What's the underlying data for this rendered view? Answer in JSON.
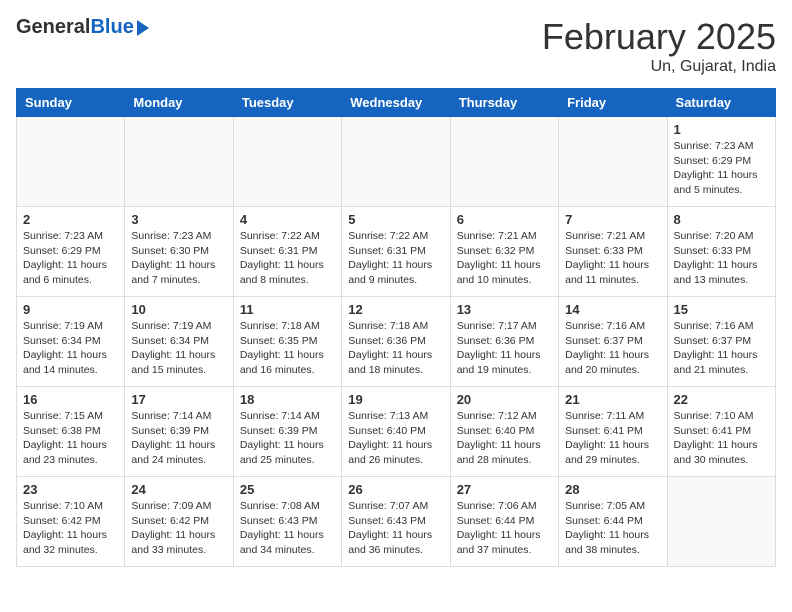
{
  "header": {
    "logo_general": "General",
    "logo_blue": "Blue",
    "title": "February 2025",
    "subtitle": "Un, Gujarat, India"
  },
  "weekdays": [
    "Sunday",
    "Monday",
    "Tuesday",
    "Wednesday",
    "Thursday",
    "Friday",
    "Saturday"
  ],
  "weeks": [
    [
      {
        "day": "",
        "info": ""
      },
      {
        "day": "",
        "info": ""
      },
      {
        "day": "",
        "info": ""
      },
      {
        "day": "",
        "info": ""
      },
      {
        "day": "",
        "info": ""
      },
      {
        "day": "",
        "info": ""
      },
      {
        "day": "1",
        "info": "Sunrise: 7:23 AM\nSunset: 6:29 PM\nDaylight: 11 hours\nand 5 minutes."
      }
    ],
    [
      {
        "day": "2",
        "info": "Sunrise: 7:23 AM\nSunset: 6:29 PM\nDaylight: 11 hours\nand 6 minutes."
      },
      {
        "day": "3",
        "info": "Sunrise: 7:23 AM\nSunset: 6:30 PM\nDaylight: 11 hours\nand 7 minutes."
      },
      {
        "day": "4",
        "info": "Sunrise: 7:22 AM\nSunset: 6:31 PM\nDaylight: 11 hours\nand 8 minutes."
      },
      {
        "day": "5",
        "info": "Sunrise: 7:22 AM\nSunset: 6:31 PM\nDaylight: 11 hours\nand 9 minutes."
      },
      {
        "day": "6",
        "info": "Sunrise: 7:21 AM\nSunset: 6:32 PM\nDaylight: 11 hours\nand 10 minutes."
      },
      {
        "day": "7",
        "info": "Sunrise: 7:21 AM\nSunset: 6:33 PM\nDaylight: 11 hours\nand 11 minutes."
      },
      {
        "day": "8",
        "info": "Sunrise: 7:20 AM\nSunset: 6:33 PM\nDaylight: 11 hours\nand 13 minutes."
      }
    ],
    [
      {
        "day": "9",
        "info": "Sunrise: 7:19 AM\nSunset: 6:34 PM\nDaylight: 11 hours\nand 14 minutes."
      },
      {
        "day": "10",
        "info": "Sunrise: 7:19 AM\nSunset: 6:34 PM\nDaylight: 11 hours\nand 15 minutes."
      },
      {
        "day": "11",
        "info": "Sunrise: 7:18 AM\nSunset: 6:35 PM\nDaylight: 11 hours\nand 16 minutes."
      },
      {
        "day": "12",
        "info": "Sunrise: 7:18 AM\nSunset: 6:36 PM\nDaylight: 11 hours\nand 18 minutes."
      },
      {
        "day": "13",
        "info": "Sunrise: 7:17 AM\nSunset: 6:36 PM\nDaylight: 11 hours\nand 19 minutes."
      },
      {
        "day": "14",
        "info": "Sunrise: 7:16 AM\nSunset: 6:37 PM\nDaylight: 11 hours\nand 20 minutes."
      },
      {
        "day": "15",
        "info": "Sunrise: 7:16 AM\nSunset: 6:37 PM\nDaylight: 11 hours\nand 21 minutes."
      }
    ],
    [
      {
        "day": "16",
        "info": "Sunrise: 7:15 AM\nSunset: 6:38 PM\nDaylight: 11 hours\nand 23 minutes."
      },
      {
        "day": "17",
        "info": "Sunrise: 7:14 AM\nSunset: 6:39 PM\nDaylight: 11 hours\nand 24 minutes."
      },
      {
        "day": "18",
        "info": "Sunrise: 7:14 AM\nSunset: 6:39 PM\nDaylight: 11 hours\nand 25 minutes."
      },
      {
        "day": "19",
        "info": "Sunrise: 7:13 AM\nSunset: 6:40 PM\nDaylight: 11 hours\nand 26 minutes."
      },
      {
        "day": "20",
        "info": "Sunrise: 7:12 AM\nSunset: 6:40 PM\nDaylight: 11 hours\nand 28 minutes."
      },
      {
        "day": "21",
        "info": "Sunrise: 7:11 AM\nSunset: 6:41 PM\nDaylight: 11 hours\nand 29 minutes."
      },
      {
        "day": "22",
        "info": "Sunrise: 7:10 AM\nSunset: 6:41 PM\nDaylight: 11 hours\nand 30 minutes."
      }
    ],
    [
      {
        "day": "23",
        "info": "Sunrise: 7:10 AM\nSunset: 6:42 PM\nDaylight: 11 hours\nand 32 minutes."
      },
      {
        "day": "24",
        "info": "Sunrise: 7:09 AM\nSunset: 6:42 PM\nDaylight: 11 hours\nand 33 minutes."
      },
      {
        "day": "25",
        "info": "Sunrise: 7:08 AM\nSunset: 6:43 PM\nDaylight: 11 hours\nand 34 minutes."
      },
      {
        "day": "26",
        "info": "Sunrise: 7:07 AM\nSunset: 6:43 PM\nDaylight: 11 hours\nand 36 minutes."
      },
      {
        "day": "27",
        "info": "Sunrise: 7:06 AM\nSunset: 6:44 PM\nDaylight: 11 hours\nand 37 minutes."
      },
      {
        "day": "28",
        "info": "Sunrise: 7:05 AM\nSunset: 6:44 PM\nDaylight: 11 hours\nand 38 minutes."
      },
      {
        "day": "",
        "info": ""
      }
    ]
  ]
}
